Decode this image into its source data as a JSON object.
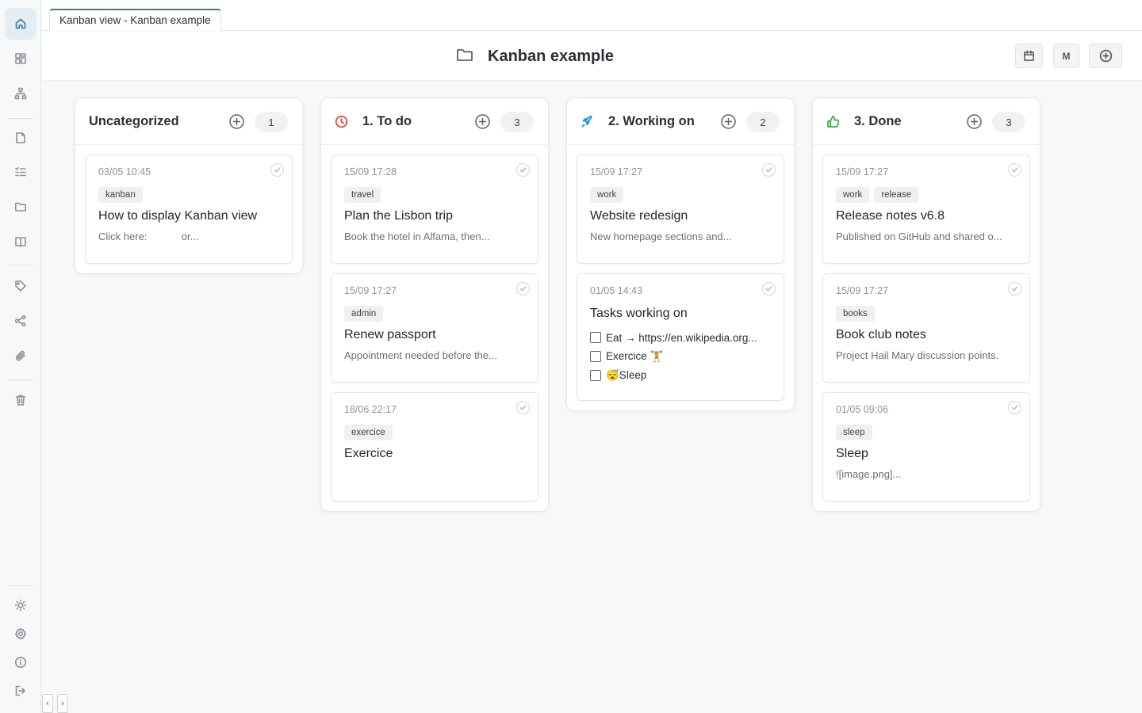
{
  "tab": {
    "label": "Kanban view - Kanban example"
  },
  "header": {
    "title": "Kanban example",
    "avatar_label": "M"
  },
  "sidebar": {
    "items": [
      "home-icon",
      "dashboard-icon",
      "hierarchy-icon",
      "note-icon",
      "tasks-icon",
      "folder-icon",
      "book-icon",
      "tag-icon",
      "share-icon",
      "paperclip-icon",
      "trash-icon",
      "sun-icon",
      "gear-icon",
      "info-icon",
      "logout-icon"
    ],
    "collapse_left": "‹",
    "collapse_right": "›"
  },
  "colors": {
    "accent": "#2e7ea6",
    "todo": "#d94040",
    "working": "#1f8fd6",
    "done": "#3aa84a"
  },
  "columns": [
    {
      "title": "Uncategorized",
      "count": "1",
      "cards": [
        {
          "date": "03/05 10:45",
          "tags": [
            "kanban"
          ],
          "title": "How to display Kanban view",
          "snippet": "Click here:            or..."
        }
      ]
    },
    {
      "title": "1. To do",
      "icon": "clock-icon",
      "count": "3",
      "cards": [
        {
          "date": "15/09 17:28",
          "tags": [
            "travel"
          ],
          "title": "Plan the Lisbon trip",
          "snippet": "Book the hotel in Alfama, then..."
        },
        {
          "date": "15/09 17:27",
          "tags": [
            "admin"
          ],
          "title": "Renew passport",
          "snippet": "Appointment needed before the..."
        },
        {
          "date": "18/06 22:17",
          "tags": [
            "exercice"
          ],
          "title": "Exercice",
          "snippet": ""
        }
      ]
    },
    {
      "title": "2. Working on",
      "icon": "rocket-icon",
      "count": "2",
      "cards": [
        {
          "date": "15/09 17:27",
          "tags": [
            "work"
          ],
          "title": "Website redesign",
          "snippet": "New homepage sections and..."
        },
        {
          "date": "01/05 14:43",
          "title": "Tasks working on",
          "checklist": [
            "Eat → https://en.wikipedia.org...",
            "Exercice 🏋",
            "😴Sleep"
          ]
        }
      ]
    },
    {
      "title": "3. Done",
      "icon": "thumbs-up-icon",
      "count": "3",
      "cards": [
        {
          "date": "15/09 17:27",
          "tags": [
            "work",
            "release"
          ],
          "title": "Release notes v6.8",
          "snippet": "Published on GitHub and shared o..."
        },
        {
          "date": "15/09 17:27",
          "tags": [
            "books"
          ],
          "title": "Book club notes",
          "snippet": "Project Hail Mary discussion points."
        },
        {
          "date": "01/05 09:06",
          "tags": [
            "sleep"
          ],
          "title": "Sleep",
          "snippet": "![image.png]..."
        }
      ]
    }
  ]
}
